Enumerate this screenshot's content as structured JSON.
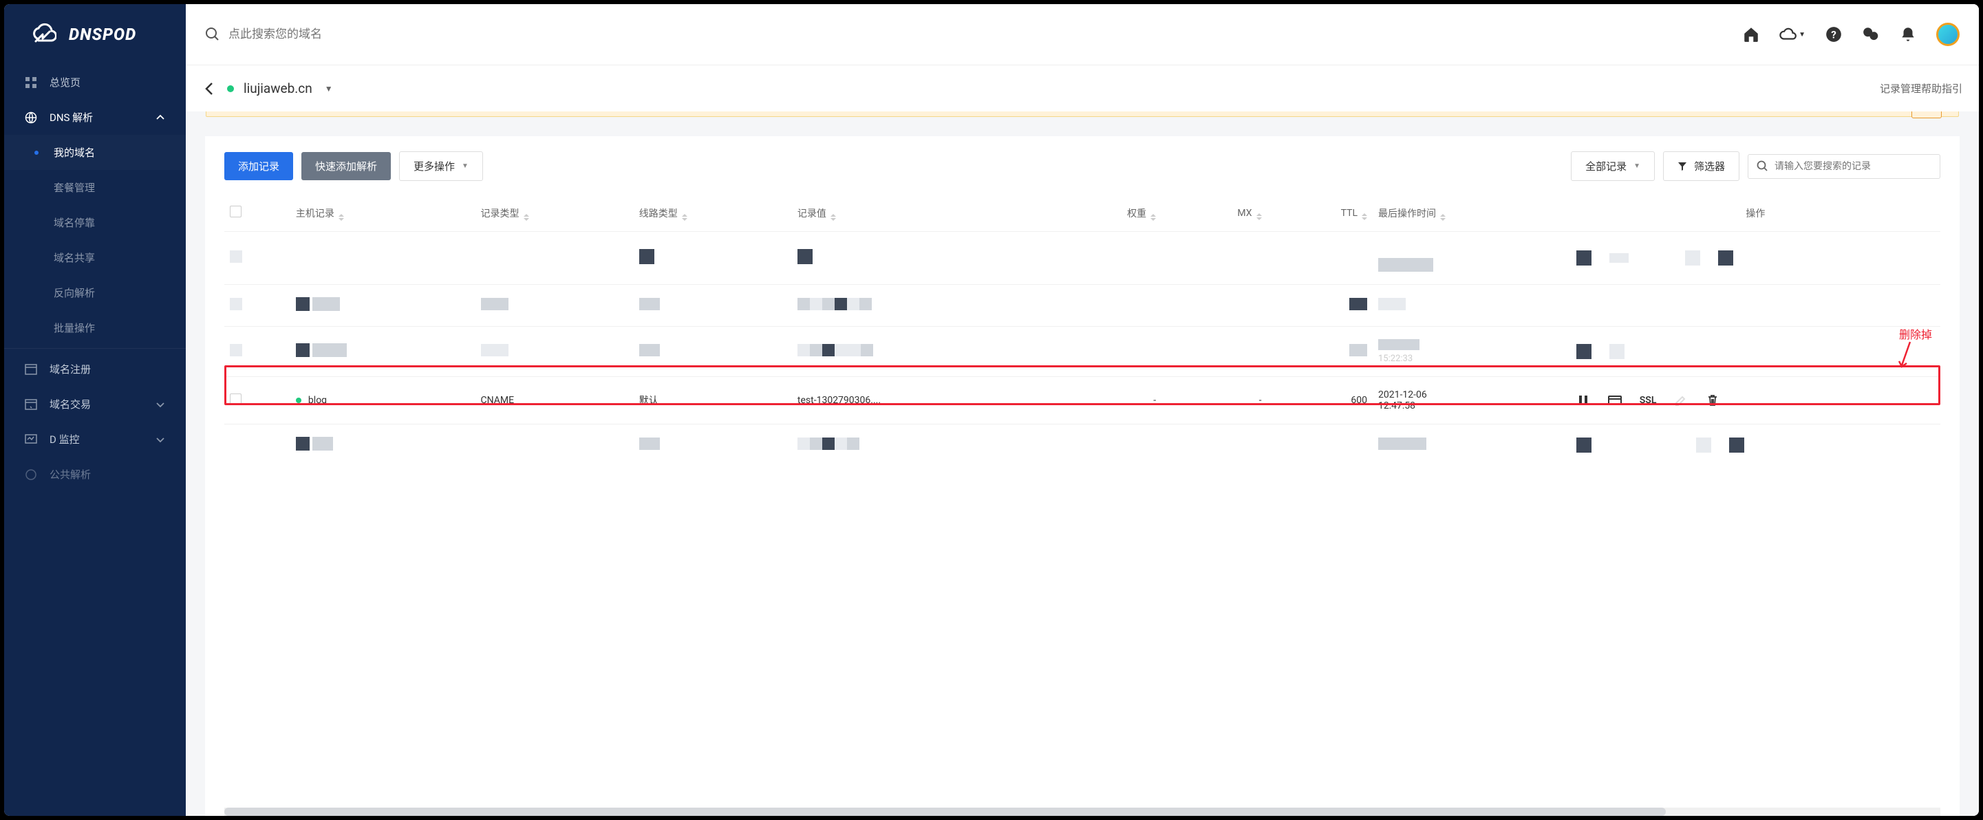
{
  "brand": {
    "name": "DNSPOD"
  },
  "search": {
    "placeholder": "点此搜索您的域名"
  },
  "sidebar": {
    "overview": "总览页",
    "dns": "DNS 解析",
    "sub": {
      "my_domains": "我的域名",
      "package": "套餐管理",
      "parking": "域名停靠",
      "share": "域名共享",
      "reverse": "反向解析",
      "batch": "批量操作"
    },
    "register": "域名注册",
    "trade": "域名交易",
    "monitor": "D 监控",
    "public": "公共解析"
  },
  "domain": {
    "name": "liujiaweb.cn",
    "help_link": "记录管理帮助指引"
  },
  "toolbar": {
    "add_record": "添加记录",
    "quick_add": "快速添加解析",
    "more_ops": "更多操作",
    "all_records": "全部记录",
    "filter": "筛选器",
    "search_placeholder": "请输入您要搜索的记录"
  },
  "columns": {
    "host": "主机记录",
    "type": "记录类型",
    "line": "线路类型",
    "value": "记录值",
    "weight": "权重",
    "mx": "MX",
    "ttl": "TTL",
    "updated": "最后操作时间",
    "actions": "操作"
  },
  "row": {
    "host": "blog",
    "type": "CNAME",
    "line": "默认",
    "value": "test-1302790306....",
    "weight": "-",
    "mx": "-",
    "ttl": "600",
    "updated_hidden": "15:22:33",
    "updated_date": "2021-12-06",
    "updated_time": "12:47:58",
    "ssl": "SSL"
  },
  "annotation": {
    "delete_label": "删除掉"
  }
}
